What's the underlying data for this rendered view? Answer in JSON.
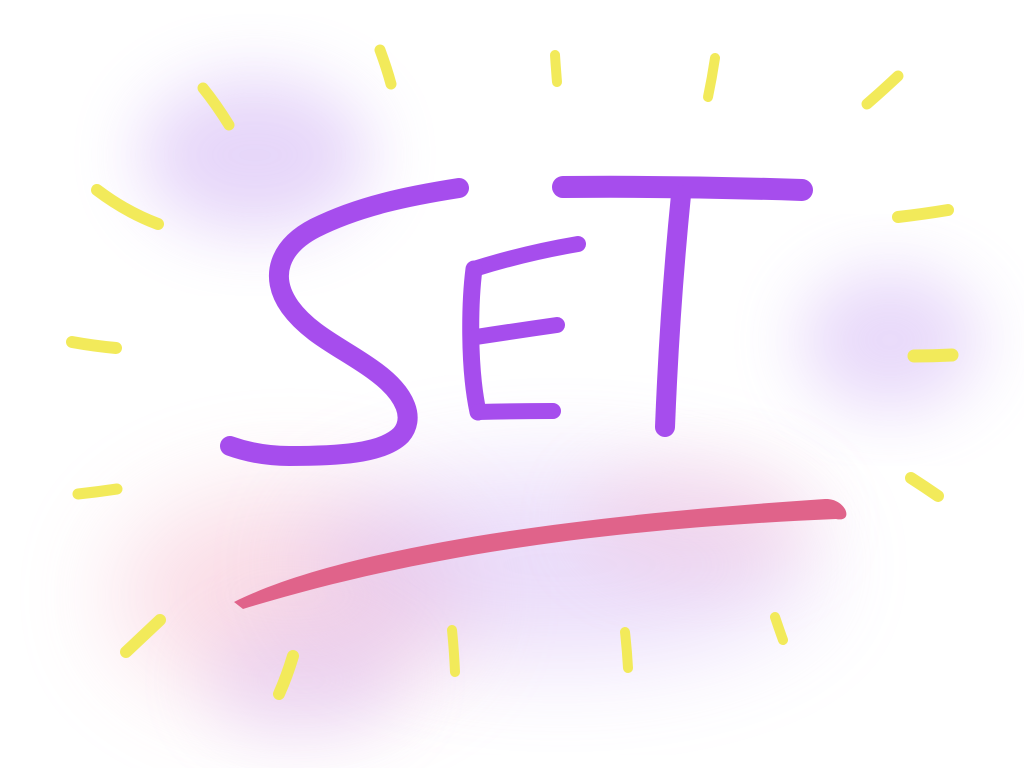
{
  "artwork": {
    "word": "SET",
    "letters": [
      "S",
      "E",
      "T"
    ],
    "colors": {
      "background": "#ffffff",
      "letters": "#a64ded",
      "underline": "#e0638a",
      "rays": "#f2ea5a",
      "glow_purple": "#c9a6f3",
      "glow_pink": "#f4b2c8"
    },
    "ray_count": 16
  }
}
